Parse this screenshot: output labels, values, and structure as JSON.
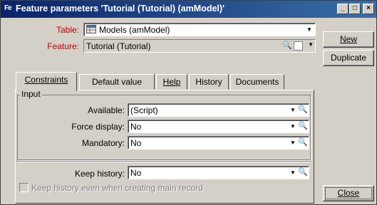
{
  "window": {
    "title": "Feature parameters 'Tutorial (Tutorial) (amModel)'",
    "icon_text": "Fe",
    "controls": {
      "minimize": "_",
      "maximize": "□",
      "close": "×"
    }
  },
  "form": {
    "table_label": "Table:",
    "table_value": "Models (amModel)",
    "feature_label": "Feature:",
    "feature_value": "Tutorial (Tutorial)"
  },
  "buttons": {
    "new": "New",
    "duplicate": "Duplicate",
    "close": "Close"
  },
  "tabs": [
    {
      "label": "Constraints",
      "active": true
    },
    {
      "label": "Default value",
      "active": false
    },
    {
      "label": "Help",
      "active": false
    },
    {
      "label": "History",
      "active": false
    },
    {
      "label": "Documents",
      "active": false
    }
  ],
  "input_group": {
    "label": "Input",
    "available_label": "Available:",
    "available_value": "(Script)",
    "force_display_label": "Force display:",
    "force_display_value": "No",
    "mandatory_label": "Mandatory:",
    "mandatory_value": "No"
  },
  "history": {
    "keep_history_label": "Keep history:",
    "keep_history_value": "No",
    "keep_history_main_label": "Keep history even when creating main record"
  }
}
